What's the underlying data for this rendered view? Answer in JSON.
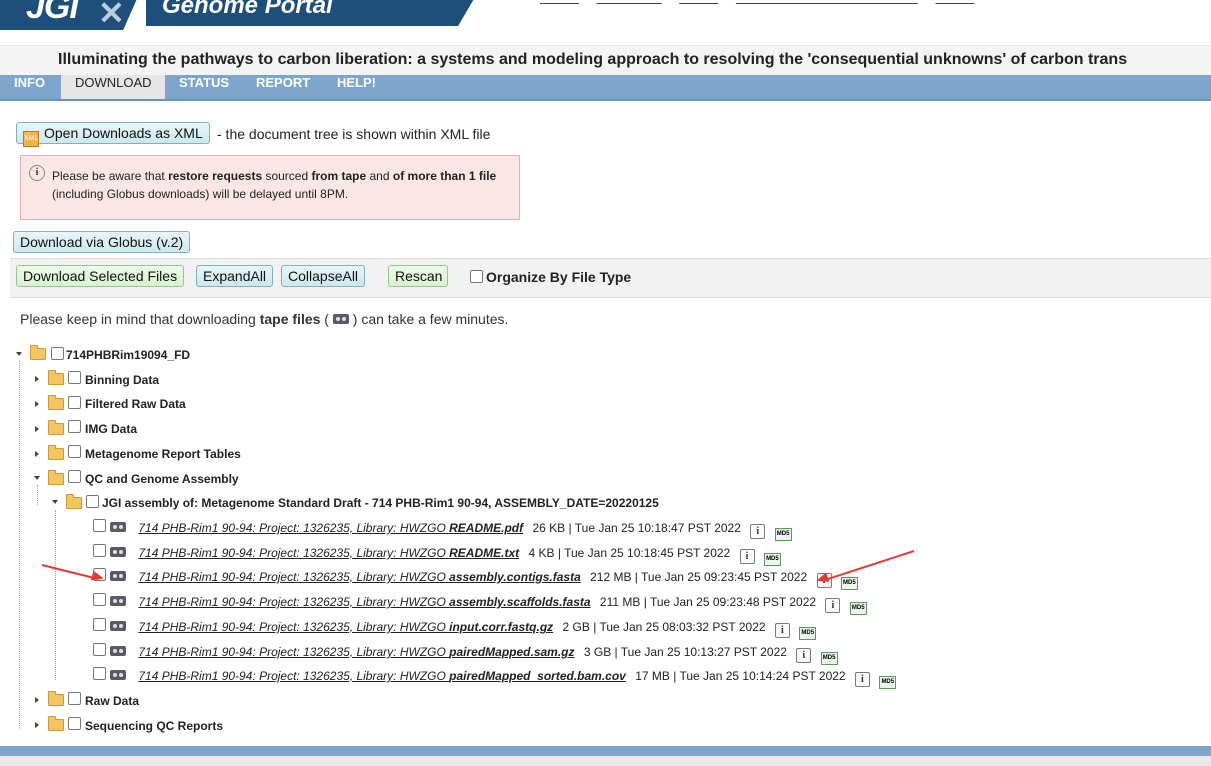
{
  "header": {
    "logo": "JGI",
    "portal_title": "Genome Portal",
    "top_links": [
      "———",
      "—————",
      "———",
      "——————————————",
      "———"
    ]
  },
  "project_title": "Illuminating the pathways to carbon liberation: a systems and modeling approach to resolving the 'consequential unknowns' of carbon trans",
  "nav": {
    "tabs": [
      "INFO",
      "DOWNLOAD",
      "STATUS",
      "REPORT",
      "HELP!"
    ],
    "active": "DOWNLOAD"
  },
  "toolbar": {
    "open_xml": "Open Downloads as XML",
    "xml_note": "- the document tree is shown within XML file",
    "globus": "Download via Globus (v.2)",
    "download_selected": "Download Selected Files",
    "expand_all": "ExpandAll",
    "collapse_all": "CollapseAll",
    "rescan": "Rescan",
    "organize": "Organize By File Type"
  },
  "warning": {
    "p1": "Please be aware that ",
    "b1": "restore requests",
    "p2": " sourced ",
    "b2": "from tape",
    "p3": " and ",
    "b3": "of more than 1 file",
    "line2": "(including Globus downloads) will be delayed until 8PM."
  },
  "tape_note": {
    "before": "Please keep in mind that downloading ",
    "bold": "tape files",
    "open": " (",
    "after": " ) can take a few minutes."
  },
  "tree": {
    "root": "714PHBRim19094_FD",
    "folders": [
      "Binning Data",
      "Filtered Raw Data",
      "IMG Data",
      "Metagenome Report Tables",
      "QC and Genome Assembly"
    ],
    "assembly": "JGI assembly of: Metagenome Standard Draft - 714 PHB-Rim1 90-94, ASSEMBLY_DATE=20220125",
    "file_prefix": "714 PHB-Rim1 90-94: Project: 1326235, Library: HWZGO ",
    "files": [
      {
        "name": "README.pdf",
        "size": "26 KB",
        "date": "Tue Jan 25 10:18:47 PST 2022"
      },
      {
        "name": "README.txt",
        "size": "4 KB",
        "date": "Tue Jan 25 10:18:45 PST 2022"
      },
      {
        "name": "assembly.contigs.fasta",
        "size": "212 MB",
        "date": "Tue Jan 25 09:23:45 PST 2022"
      },
      {
        "name": "assembly.scaffolds.fasta",
        "size": "211 MB",
        "date": "Tue Jan 25 09:23:48 PST 2022"
      },
      {
        "name": "input.corr.fastq.gz",
        "size": "2 GB",
        "date": "Tue Jan 25 08:03:32 PST 2022"
      },
      {
        "name": "pairedMapped.sam.gz",
        "size": "3 GB",
        "date": "Tue Jan 25 10:13:27 PST 2022"
      },
      {
        "name": "pairedMapped_sorted.bam.cov",
        "size": "17 MB",
        "date": "Tue Jan 25 10:14:24 PST 2022"
      }
    ],
    "more_folders": [
      "Raw Data",
      "Sequencing QC Reports"
    ],
    "info_glyph": "i",
    "md5_glyph": "MD5"
  },
  "colors": {
    "nav": "#7ea6cc",
    "brand": "#1d4f7a",
    "arrow": "#e53935"
  }
}
